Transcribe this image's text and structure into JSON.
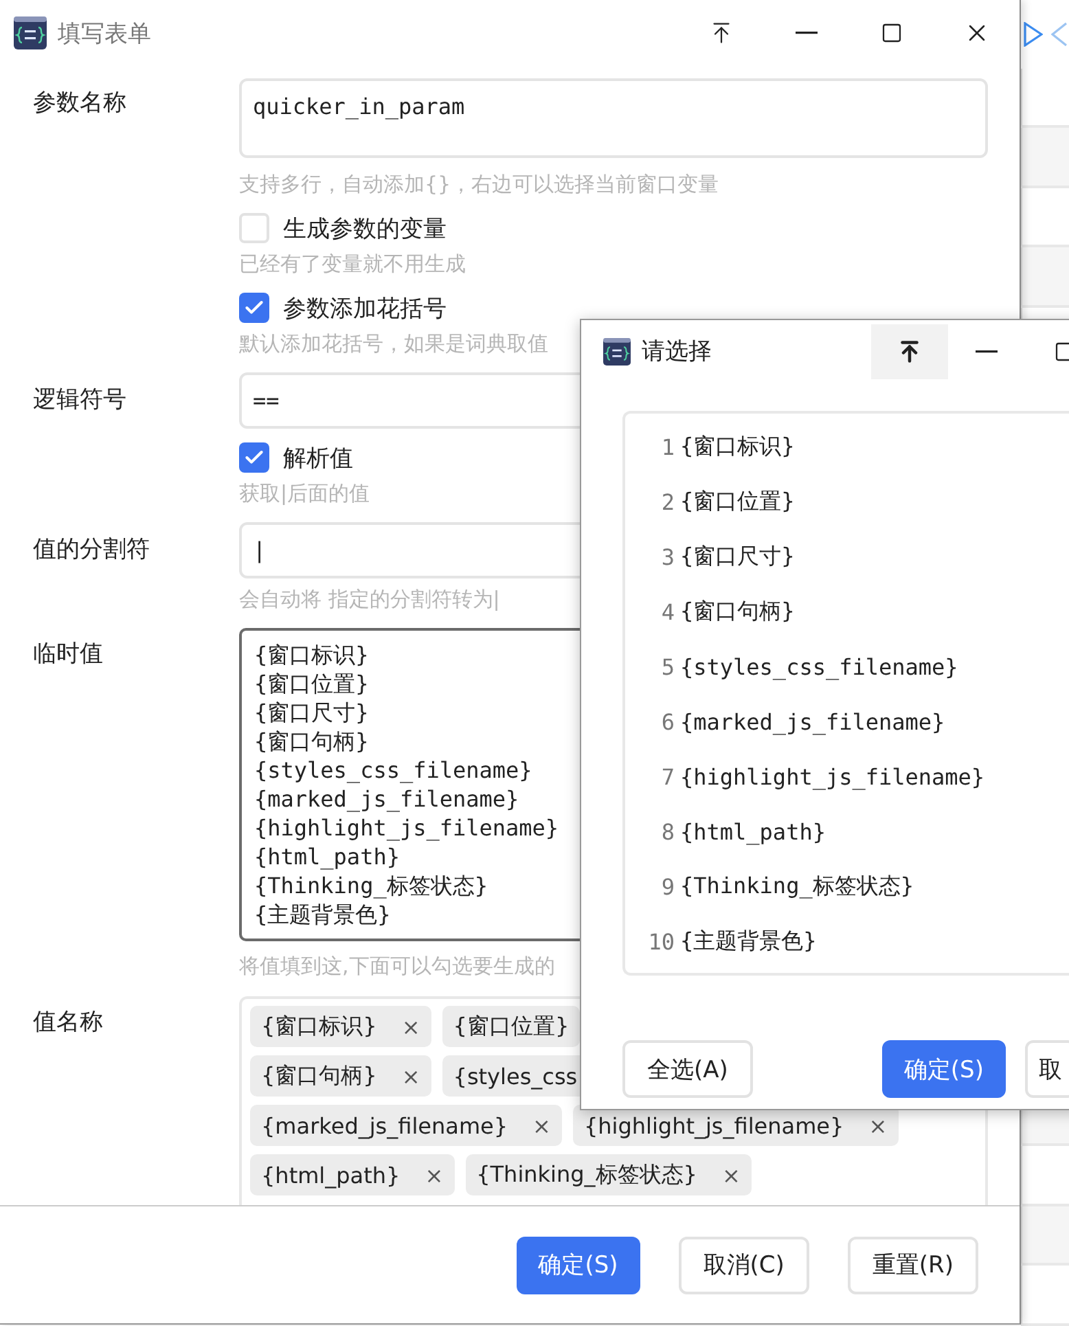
{
  "window": {
    "title": "填写表单"
  },
  "rows": [
    {
      "kind": "text",
      "label": "参数名称",
      "value": "quicker_in_param",
      "hint": "支持多行，自动添加{}，右边可以选择当前窗口变量"
    },
    {
      "kind": "checkbox",
      "label": "生成参数的变量",
      "checked": false,
      "hint": "已经有了变量就不用生成"
    },
    {
      "kind": "checkbox",
      "label": "参数添加花括号",
      "checked": true,
      "hint": "默认添加花括号，如果是词典取值"
    },
    {
      "kind": "input",
      "label": "逻辑符号",
      "value": "=="
    },
    {
      "kind": "checkbox",
      "label": "解析值",
      "checked": true,
      "hint": "获取|后面的值"
    },
    {
      "kind": "input",
      "label": "值的分割符",
      "value": "|",
      "hint": "会自动将 指定的分割符转为|"
    },
    {
      "kind": "lines",
      "label": "临时值",
      "lines": [
        "{窗口标识}",
        "{窗口位置}",
        "{窗口尺寸}",
        "{窗口句柄}",
        "{styles_css_filename}",
        "{marked_js_filename}",
        "{highlight_js_filename}",
        "{html_path}",
        "{Thinking_标签状态}",
        "{主题背景色}"
      ],
      "hint": "将值填到这,下面可以勾选要生成的"
    },
    {
      "kind": "tags",
      "label": "值名称",
      "tag_rows": [
        [
          {
            "text": "{窗口标识}",
            "close": "×"
          },
          {
            "text": "{窗口位置}"
          }
        ],
        [
          {
            "text": "{窗口句柄}",
            "close": "×"
          },
          {
            "text": "{styles_css"
          }
        ],
        [
          {
            "text": "{marked_js_filename}",
            "close": "×"
          },
          {
            "text": "{highlight_js_filename}",
            "close": "×"
          }
        ],
        [
          {
            "text": "{html_path}",
            "close": "×"
          },
          {
            "text": "{Thinking_标签状态}",
            "close": "×"
          }
        ]
      ]
    }
  ],
  "buttons": [
    {
      "label": "确定(S)",
      "primary": true
    },
    {
      "label": "取消(C)",
      "primary": false
    },
    {
      "label": "重置(R)",
      "primary": false
    }
  ],
  "dialog": {
    "title": "请选择",
    "pinned": true,
    "items": [
      {
        "number": "1",
        "text": "{窗口标识}"
      },
      {
        "number": "2",
        "text": "{窗口位置}"
      },
      {
        "number": "3",
        "text": "{窗口尺寸}"
      },
      {
        "number": "4",
        "text": "{窗口句柄}"
      },
      {
        "number": "5",
        "text": "{styles_css_filename}"
      },
      {
        "number": "6",
        "text": "{marked_js_filename}"
      },
      {
        "number": "7",
        "text": "{highlight_js_filename}"
      },
      {
        "number": "8",
        "text": "{html_path}"
      },
      {
        "number": "9",
        "text": "{Thinking_标签状态}"
      },
      {
        "number": "10",
        "text": "{主题背景色}"
      }
    ],
    "buttons": [
      {
        "label": "全选(A)",
        "primary": false
      },
      {
        "label": "确定(S)",
        "primary": true
      },
      {
        "label": "取",
        "primary": false
      }
    ]
  }
}
